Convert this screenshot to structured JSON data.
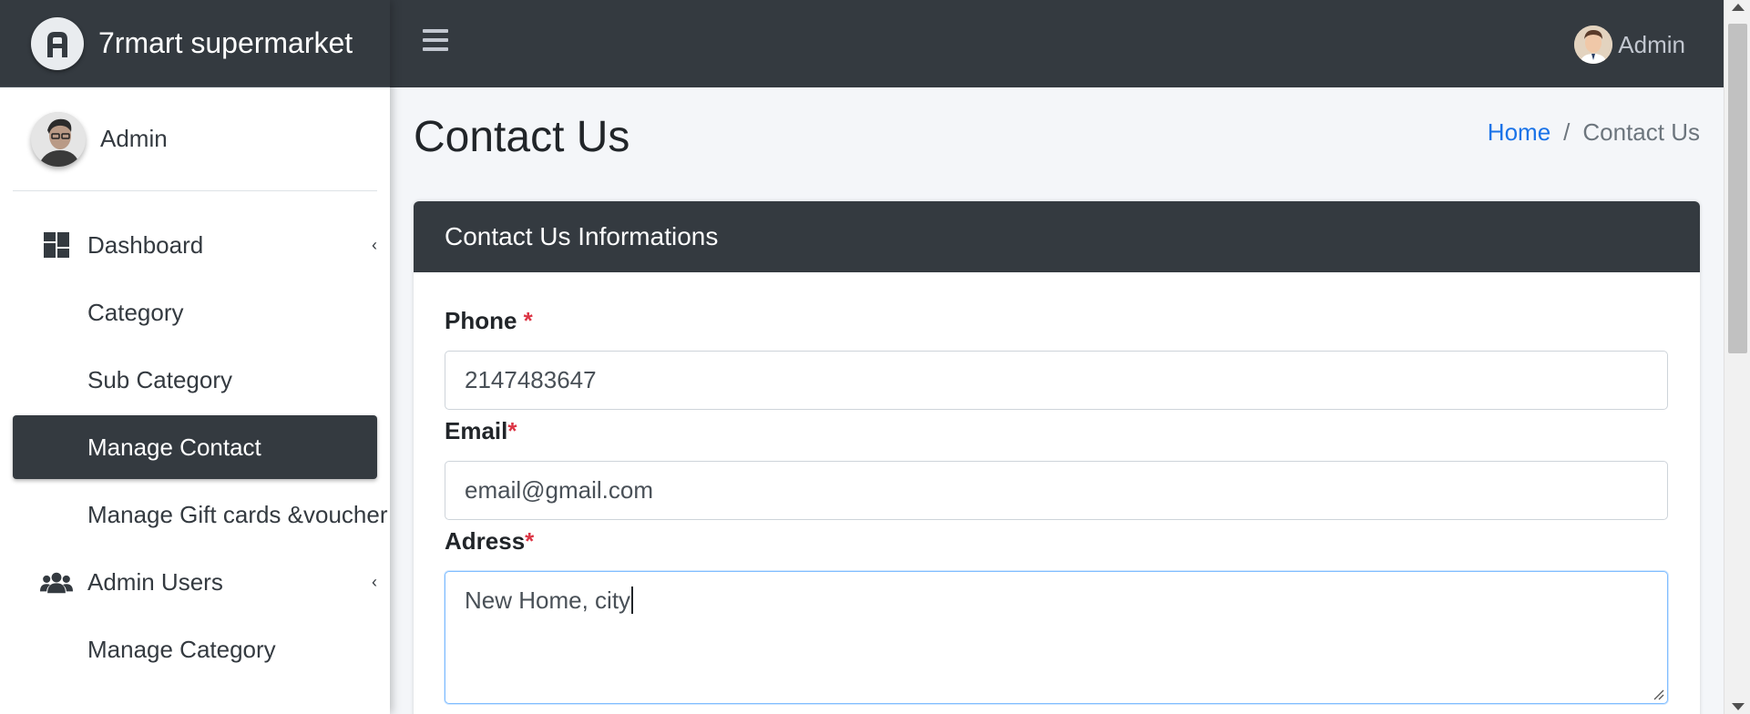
{
  "brand": {
    "name": "7rmart supermarket"
  },
  "sidebar": {
    "user_name": "Admin",
    "items": [
      {
        "label": "Dashboard",
        "icon": "dashboard-grid-icon",
        "has_arrow": true
      },
      {
        "label": "Category"
      },
      {
        "label": "Sub Category"
      },
      {
        "label": "Manage Contact",
        "active": true
      },
      {
        "label": "Manage Gift cards &voucher"
      },
      {
        "label": "Admin Users",
        "icon": "users-icon",
        "has_arrow": true
      },
      {
        "label": "Manage Category"
      }
    ],
    "arrow_glyph": "‹"
  },
  "topbar": {
    "user_name": "Admin"
  },
  "page": {
    "title": "Contact Us",
    "breadcrumb": {
      "home": "Home",
      "separator": "/",
      "current": "Contact Us"
    }
  },
  "card": {
    "title": "Contact Us Informations",
    "fields": {
      "phone": {
        "label": "Phone ",
        "required": "*",
        "value": "2147483647"
      },
      "email": {
        "label": "Email",
        "required": "*",
        "value": "email@gmail.com"
      },
      "address": {
        "label": "Adress",
        "required": "*",
        "value": "New Home, city"
      }
    }
  },
  "colors": {
    "dark": "#343a40",
    "link": "#1a73e8",
    "required": "#dc3545",
    "focus": "#80bdff"
  }
}
